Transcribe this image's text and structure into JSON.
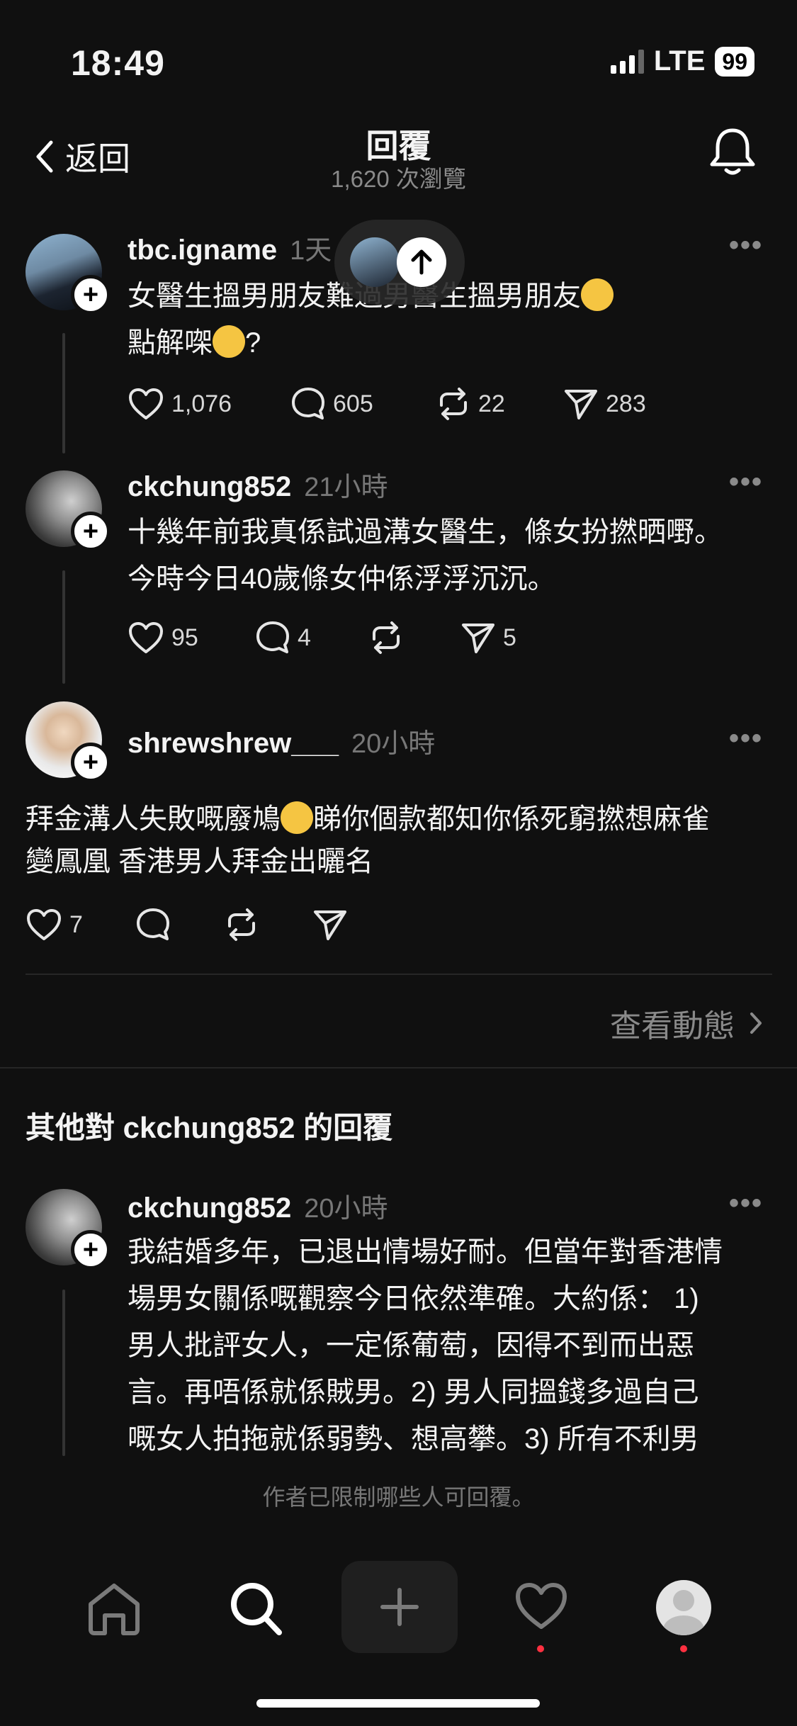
{
  "status": {
    "time": "18:49",
    "network": "LTE",
    "battery": "99"
  },
  "header": {
    "back_label": "返回",
    "title": "回覆",
    "views": "1,620 次瀏覽"
  },
  "posts": [
    {
      "username": "tbc.igname",
      "time": "1天",
      "text_line1": "女醫生搵男朋友難過男醫生搵男朋友",
      "text_line2": "點解㗎",
      "text_line2_suffix": "?",
      "likes": "1,076",
      "comments": "605",
      "reposts": "22",
      "shares": "283"
    },
    {
      "username": "ckchung852",
      "time": "21小時",
      "text_line1": "十幾年前我真係試過溝女醫生，條女扮撚晒嘢。",
      "text_line2": "今時今日40歲條女仲係浮浮沉沉。",
      "likes": "95",
      "comments": "4",
      "shares": "5"
    },
    {
      "username": "shrewshrew___",
      "time": "20小時",
      "text_line1_a": "拜金溝人失敗嘅廢鳩",
      "text_line1_b": "睇你個款都知你係死窮撚想麻雀",
      "text_line2": "變鳳凰 香港男人拜金出曬名",
      "likes": "7"
    }
  ],
  "view_activity": "查看動態",
  "other_replies_heading": "其他對 ckchung852 的回覆",
  "other_reply": {
    "username": "ckchung852",
    "time": "20小時",
    "lines": [
      "我結婚多年，已退出情場好耐。但當年對香港情",
      "場男女關係嘅觀察今日依然準確。大約係： 1)",
      "男人批評女人，一定係葡萄，因得不到而出惡",
      "言。再唔係就係賊男。2) 男人同搵錢多過自己",
      "嘅女人拍拖就係弱勢、想高攀。3) 所有不利男"
    ]
  },
  "restricted_notice": "作者已限制哪些人可回覆。",
  "icons": {
    "back": "chevron-left-icon",
    "bell": "bell-icon",
    "like": "heart-icon",
    "comment": "comment-icon",
    "repost": "repost-icon",
    "share": "send-icon",
    "home": "home-icon",
    "search": "search-icon",
    "create": "plus-icon",
    "activity": "heart-icon",
    "profile": "profile-icon",
    "scroll_top": "arrow-up-icon"
  },
  "colors": {
    "background": "#101010",
    "notification_dot": "#ff3040",
    "muted": "#777777"
  }
}
